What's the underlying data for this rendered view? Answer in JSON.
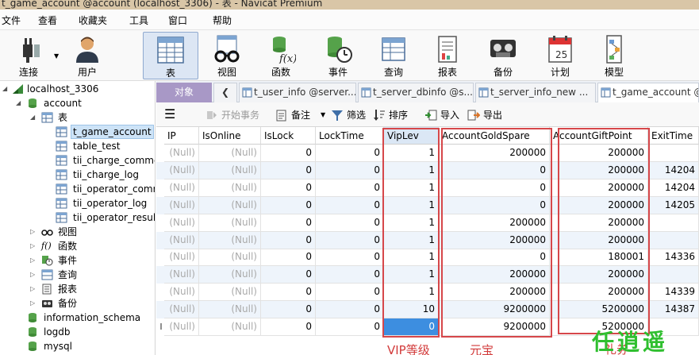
{
  "window": {
    "title": "t_game_account @account (localhost_3306) - 表 - Navicat Premium"
  },
  "menu": [
    "文件",
    "查看",
    "收藏夹",
    "工具",
    "窗口",
    "帮助"
  ],
  "toolbar": [
    {
      "label": "连接",
      "icon": "plug-icon"
    },
    {
      "label": "用户",
      "icon": "user-icon"
    },
    {
      "label": "表",
      "icon": "table-icon"
    },
    {
      "label": "视图",
      "icon": "glasses-icon"
    },
    {
      "label": "函数",
      "icon": "function-icon"
    },
    {
      "label": "事件",
      "icon": "clock-db-icon"
    },
    {
      "label": "查询",
      "icon": "query-icon"
    },
    {
      "label": "报表",
      "icon": "report-icon"
    },
    {
      "label": "备份",
      "icon": "tape-icon"
    },
    {
      "label": "计划",
      "icon": "calendar-icon"
    },
    {
      "label": "模型",
      "icon": "model-icon"
    }
  ],
  "sidebar": {
    "connection": "localhost_3306",
    "database": "account",
    "tables_node": "表",
    "tables": [
      "t_game_account",
      "table_test",
      "tii_charge_commc",
      "tii_charge_log",
      "tii_operator_comr",
      "tii_operator_log",
      "tii_operator_result"
    ],
    "other_nodes": [
      "视图",
      "函数",
      "事件",
      "查询",
      "报表",
      "备份"
    ],
    "function_glyph": "f()",
    "other_databases": [
      "information_schema",
      "logdb",
      "mysql"
    ]
  },
  "tabs": {
    "objects": "对象",
    "items": [
      "t_user_info @server...",
      "t_server_dbinfo @s...",
      "t_server_info_new ...",
      "t_game_account @ac"
    ]
  },
  "table_toolbar": {
    "begin_transaction": "开始事务",
    "memo": "备注",
    "filter": "筛选",
    "sort": "排序",
    "import": "导入",
    "export": "导出"
  },
  "grid": {
    "columns": [
      "IP",
      "IsOnline",
      "IsLock",
      "LockTime",
      "VipLev",
      "AccountGoldSpare",
      "AccountGiftPoint",
      "ExitTime"
    ],
    "null_text": "(Null)",
    "rows": [
      [
        "(Null)",
        "(Null)",
        "0",
        "0",
        "1",
        "200000",
        "200000",
        ""
      ],
      [
        "(Null)",
        "(Null)",
        "0",
        "0",
        "1",
        "0",
        "200000",
        "14204"
      ],
      [
        "(Null)",
        "(Null)",
        "0",
        "0",
        "1",
        "0",
        "200000",
        "14204"
      ],
      [
        "(Null)",
        "(Null)",
        "0",
        "0",
        "1",
        "0",
        "200000",
        "14205"
      ],
      [
        "(Null)",
        "(Null)",
        "0",
        "0",
        "1",
        "200000",
        "200000",
        ""
      ],
      [
        "(Null)",
        "(Null)",
        "0",
        "0",
        "1",
        "200000",
        "200000",
        ""
      ],
      [
        "(Null)",
        "(Null)",
        "0",
        "0",
        "1",
        "0",
        "180001",
        "14336"
      ],
      [
        "(Null)",
        "(Null)",
        "0",
        "0",
        "1",
        "200000",
        "200000",
        ""
      ],
      [
        "(Null)",
        "(Null)",
        "0",
        "0",
        "1",
        "200000",
        "200000",
        "14339"
      ],
      [
        "(Null)",
        "(Null)",
        "0",
        "0",
        "10",
        "9200000",
        "5200000",
        "14387"
      ],
      [
        "(Null)",
        "(Null)",
        "0",
        "0",
        "0",
        "9200000",
        "5200000",
        ""
      ]
    ],
    "edit_row_marker": "I"
  },
  "annotations": {
    "viplev": "VIP等级",
    "gold": "元宝",
    "gift": "礼券",
    "watermark": "任逍遥"
  },
  "colors": {
    "annotation": "#d6474a",
    "selection": "#3d8ee0",
    "objects_tab": "#a898c6",
    "watermark": "#2fbf2f"
  }
}
